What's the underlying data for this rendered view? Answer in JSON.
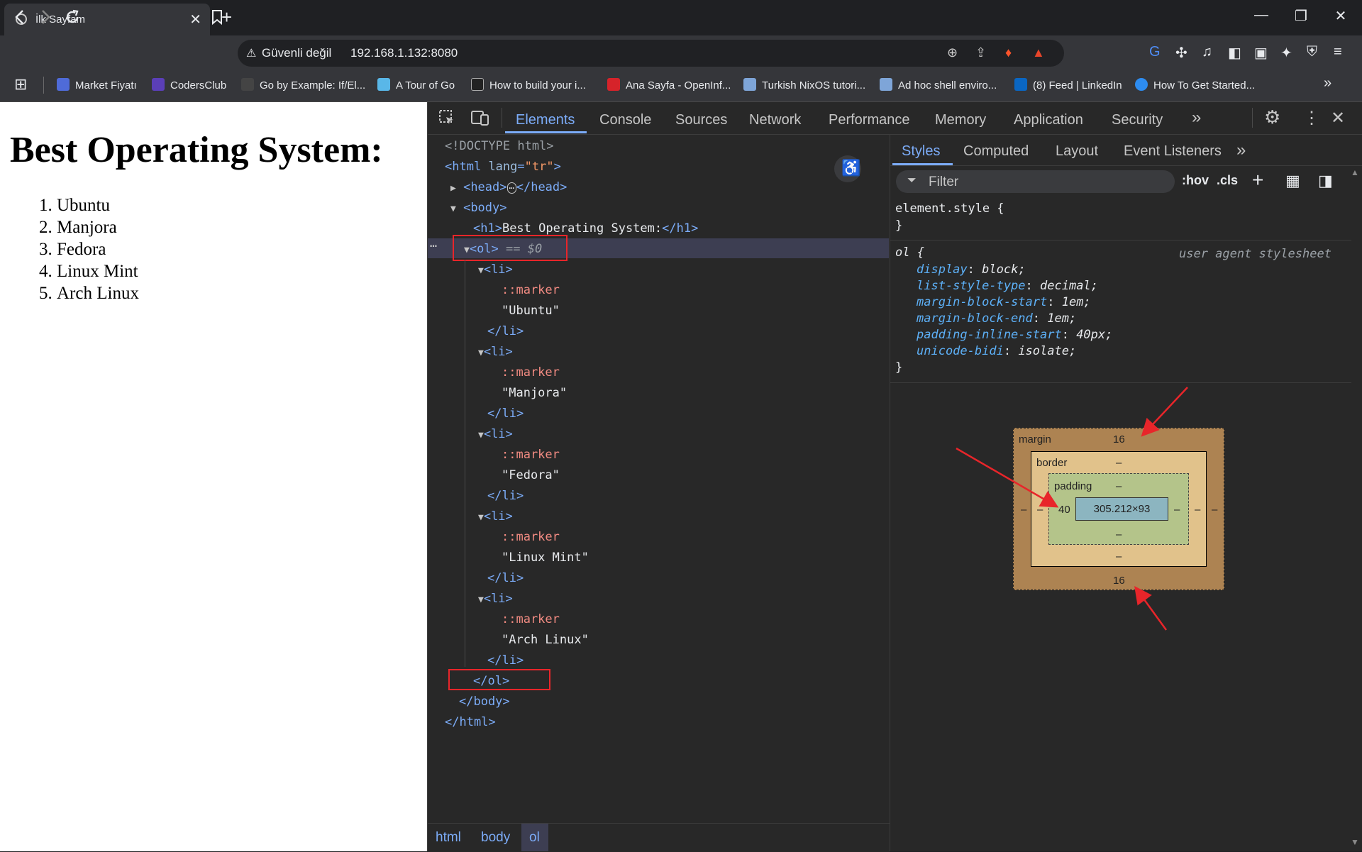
{
  "browser": {
    "tab_title": "İlk Sayfam",
    "tab_close": "✕",
    "new_tab": "+",
    "window_controls": [
      "—",
      "❐",
      "✕"
    ],
    "security_label": "Güvenli değil",
    "url": "192.168.1.132:8080"
  },
  "bookmarks": [
    {
      "label": "Market Fiyatı",
      "color": "#4f6bd8"
    },
    {
      "label": "CodersClub",
      "color": "#5b3fb8"
    },
    {
      "label": "Go by Example: If/El...",
      "color": "#444444"
    },
    {
      "label": "A Tour of Go",
      "color": "#59b7e8"
    },
    {
      "label": "How to build your i...",
      "color": "#222222"
    },
    {
      "label": "Ana Sayfa - OpenInf...",
      "color": "#d6232a"
    },
    {
      "label": "Turkish NixOS tutori...",
      "color": "#7ea5d8"
    },
    {
      "label": "Ad hoc shell enviro...",
      "color": "#7ea5d8"
    },
    {
      "label": "(8) Feed | LinkedIn",
      "color": "#0a66c2"
    },
    {
      "label": "How To Get Started...",
      "color": "#2d8cf0"
    }
  ],
  "page": {
    "heading": "Best Operating System:",
    "items": [
      "Ubuntu",
      "Manjora",
      "Fedora",
      "Linux Mint",
      "Arch Linux"
    ]
  },
  "devtools": {
    "tabs": [
      "Elements",
      "Console",
      "Sources",
      "Network",
      "Performance",
      "Memory",
      "Application",
      "Security"
    ],
    "more": "»",
    "tree": {
      "doctype": "<!DOCTYPE html>",
      "html_open": "<html",
      "lang_attr": "lang",
      "lang_val": "\"tr\"",
      "html_close_bracket": ">",
      "head": "<head>",
      "head_ellipsis": "⋯",
      "head_close": "</head>",
      "body_open": "<body>",
      "h1_open": "<h1>",
      "h1_text": "Best Operating System:",
      "h1_close": "</h1>",
      "ol_open": "<ol>",
      "ol_ref": " == $0",
      "li_open": "<li>",
      "marker": "::marker",
      "li_close": "</li>",
      "li_texts": [
        "\"Ubuntu\"",
        "\"Manjora\"",
        "\"Fedora\"",
        "\"Linux Mint\"",
        "\"Arch Linux\""
      ],
      "ol_close": "</ol>",
      "body_close": "</body>",
      "html_close": "</html>",
      "row_dots": "⋯"
    },
    "subtabs": [
      "Styles",
      "Computed",
      "Layout",
      "Event Listeners"
    ],
    "filter_placeholder": "Filter",
    "hov": ":hov",
    "cls": ".cls",
    "element_style": "element.style {",
    "close_brace": "}",
    "ol_rule": "ol {",
    "ua_label": "user agent stylesheet",
    "declarations": [
      {
        "prop": "display",
        "val": "block;"
      },
      {
        "prop": "list-style-type",
        "val": "decimal;"
      },
      {
        "prop": "margin-block-start",
        "val": "1em;"
      },
      {
        "prop": "margin-block-end",
        "val": "1em;"
      },
      {
        "prop": "padding-inline-start",
        "val": "40px;"
      },
      {
        "prop": "unicode-bidi",
        "val": "isolate;"
      }
    ],
    "box_model": {
      "margin_label": "margin",
      "margin_top": "16",
      "margin_bottom": "16",
      "margin_left": "–",
      "margin_right": "–",
      "border_label": "border",
      "border_top": "–",
      "border_bottom": "–",
      "border_left": "–",
      "border_right": "–",
      "padding_label": "padding",
      "padding_top": "–",
      "padding_bottom": "–",
      "padding_left": "40",
      "padding_right": "–",
      "content_size": "305.212×93"
    },
    "breadcrumbs": [
      "html",
      "body",
      "ol"
    ]
  }
}
